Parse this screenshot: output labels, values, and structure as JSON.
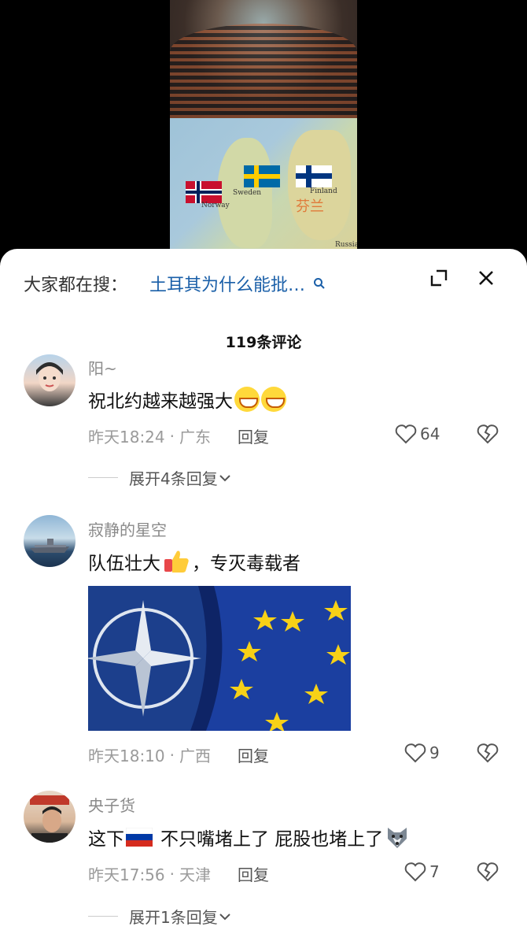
{
  "search": {
    "prefix": "大家都在搜：",
    "term": "土耳其为什么能批…"
  },
  "map_labels": {
    "norway": "Norway",
    "sweden": "Sweden",
    "finland": "Finland",
    "finland_cn": "芬兰",
    "russia": "Russia"
  },
  "comments_count": "119条评论",
  "comments": [
    {
      "username": "阳~",
      "text": "祝北约越来越强大",
      "time": "昨天18:24",
      "location": "广东",
      "reply": "回复",
      "likes": "64",
      "expand": "展开4条回复",
      "emojis": [
        "grinning-face",
        "grinning-face"
      ]
    },
    {
      "username": "寂静的星空",
      "text_before": "队伍壮大",
      "text_after": "，专灭毒载者",
      "time": "昨天18:10",
      "location": "广西",
      "reply": "回复",
      "likes": "9",
      "image": "nato-eu-flags"
    },
    {
      "username": "央子货",
      "text_a": "这下",
      "text_b": "不只嘴堵上了 屁股也堵上了",
      "time": "昨天17:56",
      "location": "天津",
      "reply": "回复",
      "likes": "7",
      "expand": "展开1条回复"
    }
  ],
  "separator": "·",
  "colors": {
    "accent_link": "#1a5fa8",
    "meta_gray": "#9a9a9a",
    "nato_blue": "#1c3f8c",
    "eu_blue": "#1b3fa0",
    "eu_star": "#f7d117"
  }
}
